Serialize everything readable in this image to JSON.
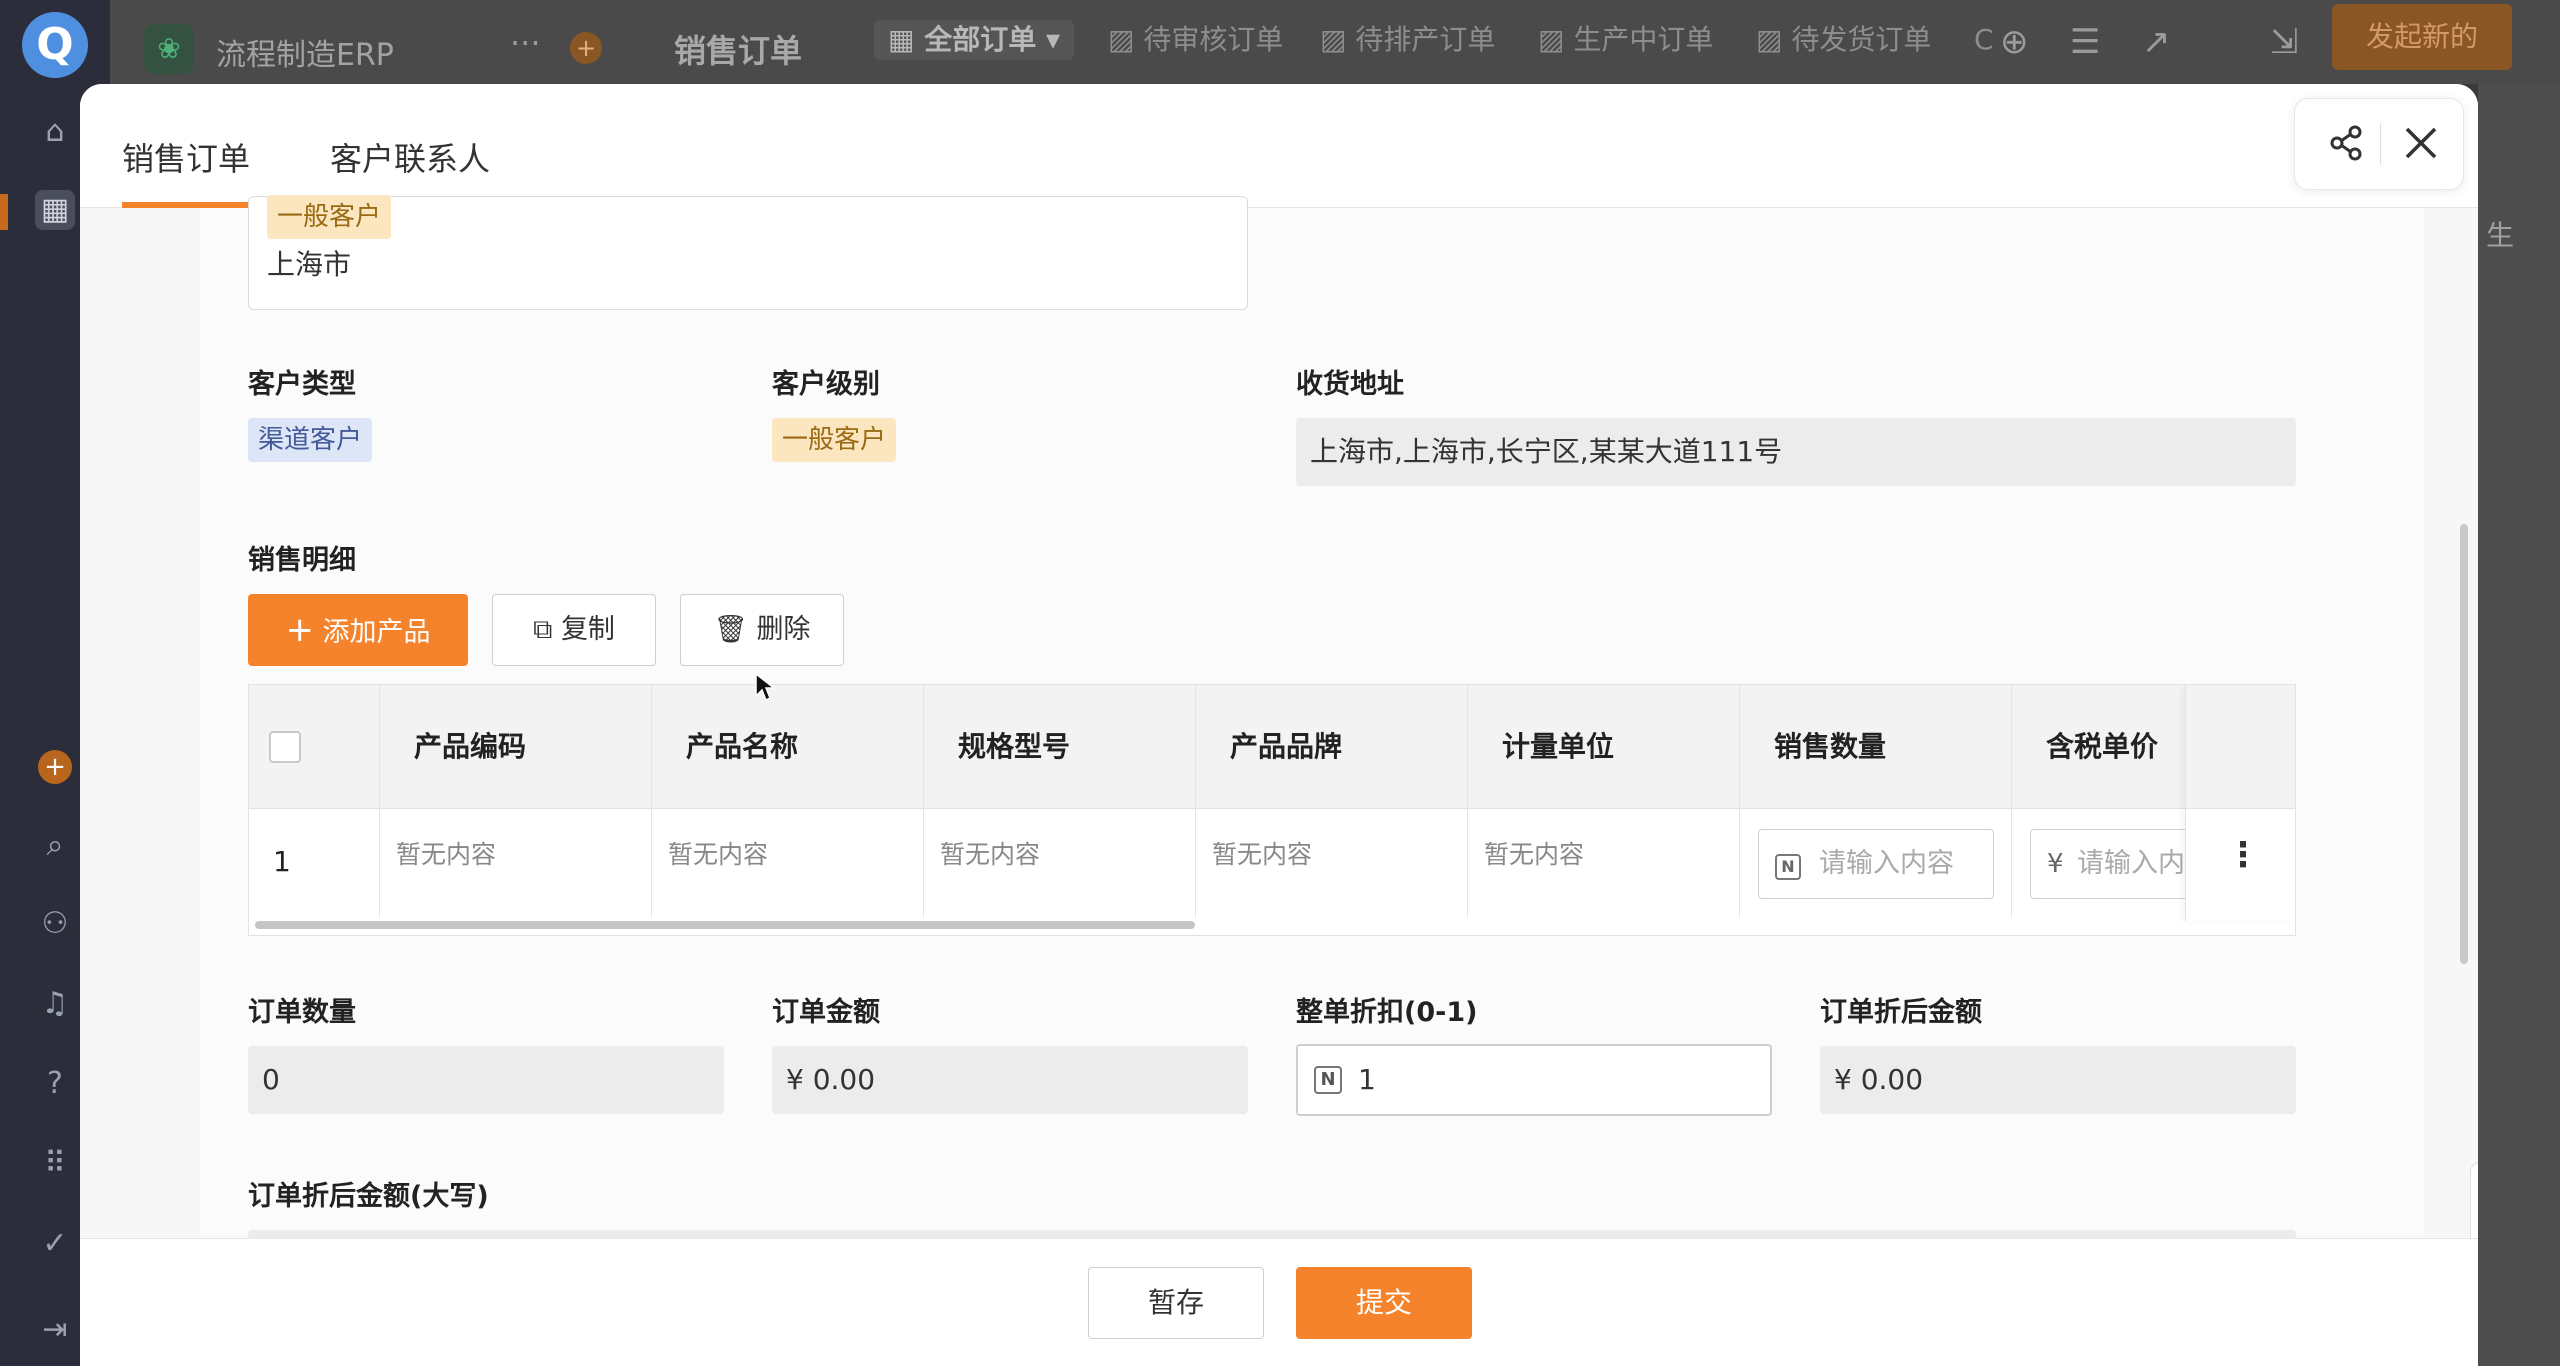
{
  "rail": {
    "logo": "Q",
    "icons": [
      "home-icon",
      "apps-icon",
      "add-icon",
      "search-icon",
      "users-icon",
      "bell-icon",
      "help-icon",
      "grid-icon",
      "check-icon",
      "collapse-icon"
    ]
  },
  "topbar": {
    "app_name": "流程制造ERP",
    "menu_title": "销售订单",
    "tabs": [
      "全部订单",
      "待审核订单",
      "待排产订单",
      "生产中订单",
      "待发货订单"
    ],
    "overflow_char": "C",
    "launch_button": "发起新的",
    "right_char": "生"
  },
  "modal": {
    "tabs": [
      "销售订单",
      "客户联系人"
    ],
    "partial_tag": "一般客户",
    "partial_city": "上海市",
    "labels": {
      "customer_type": "客户类型",
      "customer_level": "客户级别",
      "shipping_address": "收货地址",
      "sales_detail": "销售明细",
      "order_qty": "订单数量",
      "order_amount": "订单金额",
      "discount": "整单折扣(0-1)",
      "discounted_amount": "订单折后金额",
      "discounted_amount_upper": "订单折后金额(大写)"
    },
    "values": {
      "customer_type": "渠道客户",
      "customer_level": "一般客户",
      "shipping_address": "上海市,上海市,长宁区,某某大道111号",
      "order_qty": "0",
      "order_amount": "¥ 0.00",
      "discount": "1",
      "discounted_amount": "¥ 0.00"
    },
    "buttons": {
      "add_product": "添加产品",
      "copy": "复制",
      "delete": "删除"
    },
    "table": {
      "headers": [
        "产品编码",
        "产品名称",
        "规格型号",
        "产品品牌",
        "计量单位",
        "销售数量",
        "含税单价"
      ],
      "rows": [
        {
          "index": "1",
          "code": "暂无内容",
          "name": "暂无内容",
          "spec": "暂无内容",
          "brand": "暂无内容",
          "unit": "暂无内容",
          "qty_placeholder": "请输入内容",
          "price_placeholder": "请输入内"
        }
      ]
    },
    "footer": {
      "save": "暂存",
      "submit": "提交"
    }
  },
  "colors": {
    "accent": "#f5832b",
    "tag_orange_bg": "#fbe6bf",
    "tag_blue_bg": "#dde6f7"
  }
}
